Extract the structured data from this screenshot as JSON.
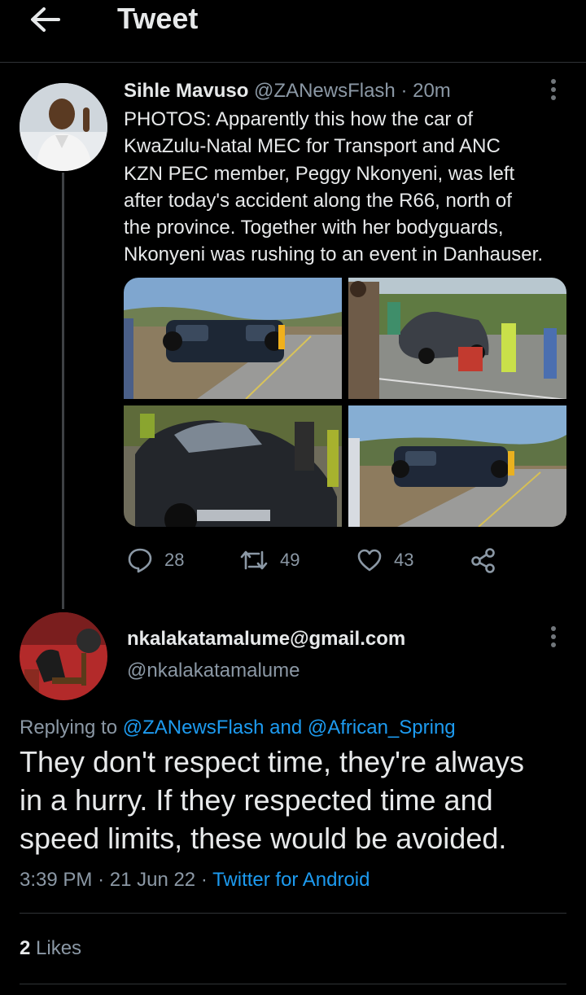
{
  "header": {
    "title": "Tweet"
  },
  "original_tweet": {
    "author_name": "Sihle Mavuso",
    "author_handle": "@ZANewsFlash",
    "time_ago": "20m",
    "text_lines": [
      "PHOTOS: Apparently this how the car of",
      "KwaZulu-Natal MEC for Transport and ANC",
      "KZN PEC member, Peggy Nkonyeni, was left",
      "after today's accident along the R66, north of",
      "the province. Together with her bodyguards,",
      "Nkonyeni was rushing to an event in Danhauser."
    ],
    "actions": {
      "replies": "28",
      "retweets": "49",
      "likes": "43"
    }
  },
  "reply_tweet": {
    "author_name": "nkalakatamalume@gmail.com",
    "author_handle": "@nkalakatamalume",
    "replying_prefix": "Replying to",
    "replying_to_1": "@ZANewsFlash",
    "replying_and": "and",
    "replying_to_2": "@African_Spring",
    "text_lines": [
      "They don't respect time, they're always",
      "in a hurry. If they respected time and",
      "speed limits, these would be avoided."
    ],
    "time": "3:39 PM",
    "date": "21 Jun 22",
    "source": "Twitter for Android",
    "like_count": "2",
    "likes_label": "Likes"
  },
  "colors": {
    "background": "#000000",
    "text": "#e7e9ea",
    "secondary": "#8b98a5",
    "link": "#1d9bf0",
    "divider": "#2f3336"
  }
}
